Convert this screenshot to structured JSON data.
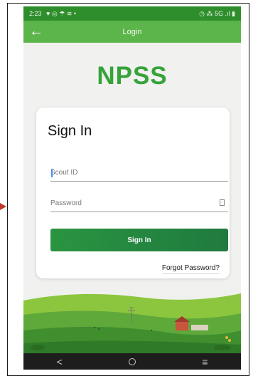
{
  "status": {
    "time": "2:23",
    "left_icons": "♥ ◎ ☂ ≋ •",
    "right_icons": "◷ ⁂ 5G .ıl ▮"
  },
  "appbar": {
    "title": "Login",
    "back_icon": "arrow-left-icon"
  },
  "brand": {
    "logo": "NPSS",
    "color": "#36a33a"
  },
  "form": {
    "title": "Sign In",
    "scout_id_placeholder": "Scout ID",
    "password_placeholder": "Password",
    "eye_icon": "visibility-toggle-icon",
    "submit_label": "Sign In",
    "forgot_label": "Forgot Password?"
  },
  "navbar": {
    "back": "<",
    "menu": "≡"
  },
  "colors": {
    "statusbar": "#2f8e2c",
    "appbar": "#5cb54a",
    "button": "#1f7a3f"
  }
}
